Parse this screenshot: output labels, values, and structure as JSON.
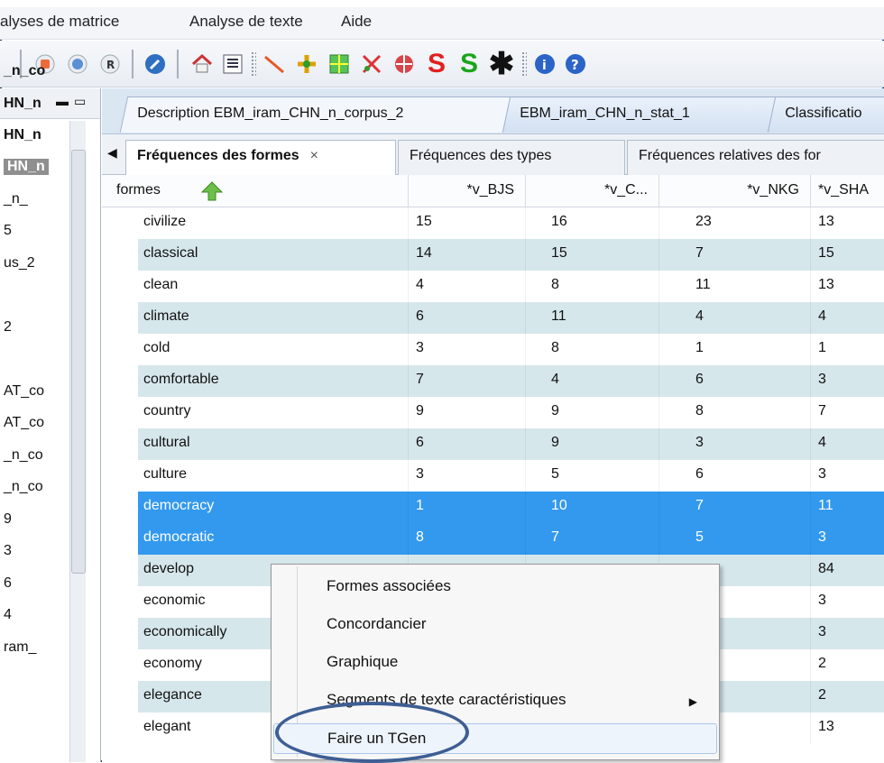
{
  "menubar": {
    "items": [
      "alyses de matrice",
      "Analyse de texte",
      "Aide"
    ]
  },
  "toolbar": {
    "icons": [
      "stop-icon",
      "globe-icon",
      "r-icon",
      "wrench-icon",
      "home-icon",
      "list-icon",
      "line-chart-icon",
      "plus-star-icon",
      "grid-icon",
      "scatter-icon",
      "globe-red-icon",
      "s-icon",
      "s-green-icon",
      "asterisk-icon",
      "info-icon",
      "help-icon"
    ]
  },
  "leftpane": {
    "items": [
      "_n_co",
      "HN_n",
      "HN_n",
      "HN_n",
      "_n_",
      "5",
      "us_2",
      "",
      "2",
      "",
      "AT_co",
      "AT_co",
      "_n_co",
      "_n_co",
      "9",
      "3",
      "6",
      "4",
      "ram_"
    ]
  },
  "tabs1": [
    "Description EBM_iram_CHN_n_corpus_2",
    "EBM_iram_CHN_n_stat_1",
    "Classificatio"
  ],
  "tabs2": {
    "active": "Fréquences des formes",
    "close": "×",
    "others": [
      "Fréquences des types",
      "Fréquences relatives des for"
    ]
  },
  "table": {
    "columns": [
      "formes",
      "*v_BJS",
      "*v_C...",
      "*v_NKG",
      "*v_SHA"
    ],
    "rows": [
      {
        "forme": "civilize",
        "v1": "15",
        "v2": "16",
        "v3": "23",
        "v4": "13",
        "state": "normal"
      },
      {
        "forme": "classical",
        "v1": "14",
        "v2": "15",
        "v3": "7",
        "v4": "15",
        "state": "alt"
      },
      {
        "forme": "clean",
        "v1": "4",
        "v2": "8",
        "v3": "11",
        "v4": "13",
        "state": "normal"
      },
      {
        "forme": "climate",
        "v1": "6",
        "v2": "11",
        "v3": "4",
        "v4": "4",
        "state": "alt"
      },
      {
        "forme": "cold",
        "v1": "3",
        "v2": "8",
        "v3": "1",
        "v4": "1",
        "state": "normal"
      },
      {
        "forme": "comfortable",
        "v1": "7",
        "v2": "4",
        "v3": "6",
        "v4": "3",
        "state": "alt"
      },
      {
        "forme": "country",
        "v1": "9",
        "v2": "9",
        "v3": "8",
        "v4": "7",
        "state": "normal"
      },
      {
        "forme": "cultural",
        "v1": "6",
        "v2": "9",
        "v3": "3",
        "v4": "4",
        "state": "alt"
      },
      {
        "forme": "culture",
        "v1": "3",
        "v2": "5",
        "v3": "6",
        "v4": "3",
        "state": "normal"
      },
      {
        "forme": "democracy",
        "v1": "1",
        "v2": "10",
        "v3": "7",
        "v4": "11",
        "state": "selected"
      },
      {
        "forme": "democratic",
        "v1": "8",
        "v2": "7",
        "v3": "5",
        "v4": "3",
        "state": "selected"
      },
      {
        "forme": "develop",
        "v1": "",
        "v2": "",
        "v3": "",
        "v4": "84",
        "state": "alt"
      },
      {
        "forme": "economic",
        "v1": "",
        "v2": "",
        "v3": "",
        "v4": "3",
        "state": "normal"
      },
      {
        "forme": "economically",
        "v1": "",
        "v2": "",
        "v3": "",
        "v4": "3",
        "state": "alt"
      },
      {
        "forme": "economy",
        "v1": "",
        "v2": "",
        "v3": "",
        "v4": "2",
        "state": "normal"
      },
      {
        "forme": "elegance",
        "v1": "",
        "v2": "",
        "v3": "",
        "v4": "2",
        "state": "alt"
      },
      {
        "forme": "elegant",
        "v1": "",
        "v2": "",
        "v3": "",
        "v4": "13",
        "state": "normal"
      }
    ]
  },
  "context_menu": {
    "items": [
      {
        "label": "Formes associées",
        "submenu": false
      },
      {
        "label": "Concordancier",
        "submenu": false
      },
      {
        "label": "Graphique",
        "submenu": false
      },
      {
        "label": "Segments de texte caractéristiques",
        "submenu": true
      },
      {
        "label": "Faire un TGen",
        "submenu": false
      }
    ],
    "submenu_arrow": "▶"
  },
  "colors": {
    "selected": "#3399ee",
    "alt_row": "#d6e7ec",
    "header_arrow": "#6cc04a"
  }
}
